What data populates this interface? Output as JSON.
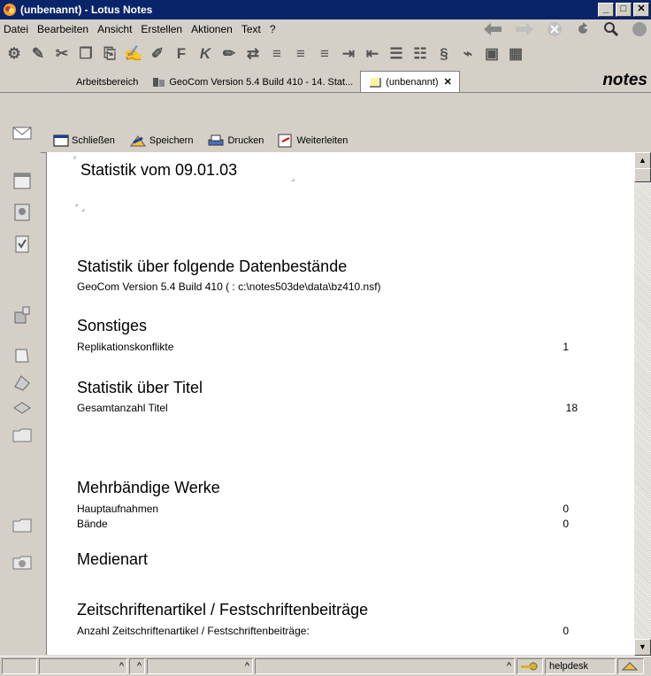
{
  "window": {
    "title": "(unbenannt) - Lotus Notes",
    "min": "_",
    "max": "□",
    "close": "✕"
  },
  "menu": [
    "Datei",
    "Bearbeiten",
    "Ansicht",
    "Erstellen",
    "Aktionen",
    "Text",
    "?"
  ],
  "tabs": [
    {
      "label": "Arbeitsbereich"
    },
    {
      "label": "GeoCom Version 5.4  Build 410 - 14. Stat..."
    },
    {
      "label": "(unbenannt)",
      "close": "✕"
    }
  ],
  "brand": "notes",
  "actions": {
    "close": "Schließen",
    "save": "Speichern",
    "print": "Drucken",
    "forward": "Weiterleiten"
  },
  "doc": {
    "title": "Statistik vom 09.01.03",
    "sec1": {
      "heading": "Statistik über folgende Datenbestände",
      "line": "GeoCom Version 5.4  Build 410 ( : c:\\notes503de\\data\\bz410.nsf)"
    },
    "sec2": {
      "heading": "Sonstiges",
      "label": "Replikationskonflikte",
      "value": "1"
    },
    "sec3": {
      "heading": "Statistik über Titel",
      "label": "Gesamtanzahl Titel",
      "value": "18"
    },
    "sec4": {
      "heading": "Mehrbändige Werke",
      "label1": "Hauptaufnahmen",
      "value1": "0",
      "label2": "Bände",
      "value2": "0"
    },
    "sec5": {
      "heading": "Medienart"
    },
    "sec6": {
      "heading": "Zeitschriftenartikel / Festschriftenbeiträge",
      "label": "Anzahl Zeitschriftenartikel / Festschriftenbeiträge:",
      "value": "0"
    }
  },
  "status": {
    "user": "helpdesk"
  },
  "colors": {
    "titlebar": "#0a246a",
    "chrome": "#d4d0c8"
  }
}
